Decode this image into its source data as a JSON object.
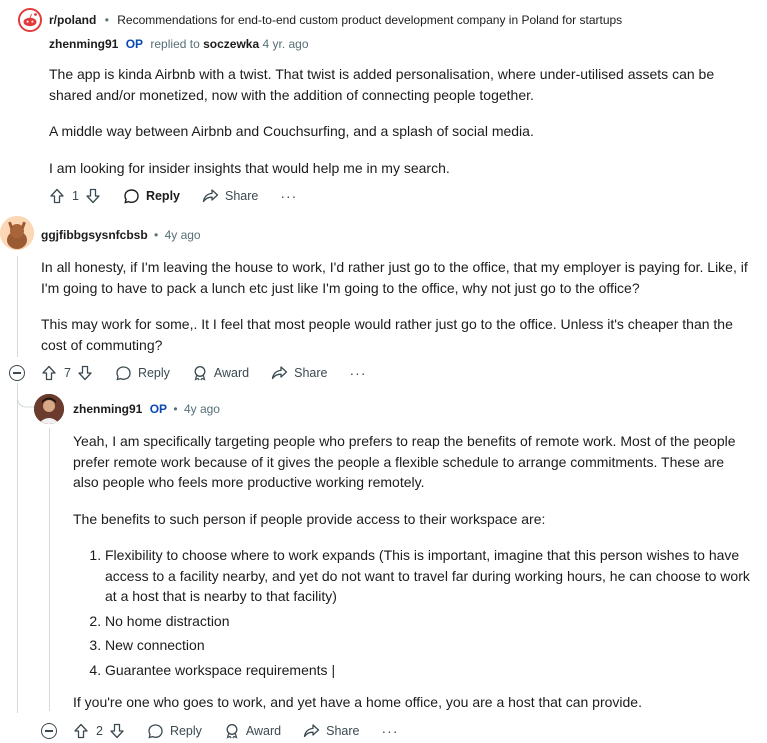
{
  "header": {
    "subreddit": "r/poland",
    "separator": "•",
    "post_title": "Recommendations for end-to-end custom product development company in Poland for startups"
  },
  "comment1": {
    "author": "zhenming91",
    "op_badge": "OP",
    "replied_text": "replied to",
    "replied_to": "soczewka",
    "time": "4 yr. ago",
    "paragraphs": [
      "The app is kinda Airbnb with a twist. That twist is added personalisation, where under-utilised assets can be shared and/or monetized, now with the addition of connecting people together.",
      "A middle way between Airbnb and Couchsurfing, and a splash of social media.",
      "I am looking for insider insights that would help me in my search."
    ],
    "actions": {
      "votes": "1",
      "reply": "Reply",
      "share": "Share",
      "more": "···"
    }
  },
  "comment2": {
    "author": "ggjfibbgsysnfcbsb",
    "dot": "•",
    "time": "4y ago",
    "paragraphs": [
      "In all honesty, if I'm leaving the house to work, I'd rather just go to the office, that my employer is paying for. Like, if I'm going to have to pack a lunch etc just like I'm going to the office, why not just go to the office?",
      "This may work for some,. It I feel that most people would rather just go to the office. Unless it's cheaper than the cost of commuting?"
    ],
    "actions": {
      "votes": "7",
      "reply": "Reply",
      "award": "Award",
      "share": "Share",
      "more": "···"
    }
  },
  "comment3": {
    "author": "zhenming91",
    "op_badge": "OP",
    "dot": "•",
    "time": "4y ago",
    "paragraphs": [
      "Yeah, I am specifically targeting people who prefers to reap the benefits of remote work. Most of the people prefer remote work because of it gives the people a flexible schedule to arrange commitments. These are also people who feels more productive working remotely.",
      "The benefits to such person if people provide access to their workspace are:"
    ],
    "list": [
      "Flexibility to choose where to work expands (This is important, imagine that this person wishes to have access to a facility nearby, and yet do not want to travel far during working hours, he can choose to work at a host that is nearby to that facility)",
      "No home distraction",
      "New connection",
      "Guarantee workspace requirements |"
    ],
    "closing": "If you're one who goes to work, and yet have a home office, you are a host that can provide.",
    "actions": {
      "votes": "2",
      "reply": "Reply",
      "award": "Award",
      "share": "Share",
      "more": "···"
    }
  }
}
